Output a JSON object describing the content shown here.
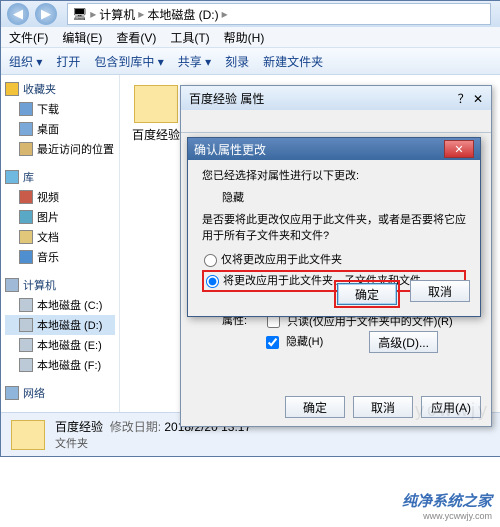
{
  "titlebar": {
    "back_glyph": "◀",
    "fwd_glyph": "▶",
    "crumb_icon": "🖥",
    "crumb1": "计算机",
    "crumb2": "本地磁盘 (D:)",
    "sep": "▸"
  },
  "menubar": {
    "file": "文件(F)",
    "edit": "编辑(E)",
    "view": "查看(V)",
    "tools": "工具(T)",
    "help": "帮助(H)"
  },
  "toolbar": {
    "organize": "组织 ▾",
    "open": "打开",
    "include": "包含到库中 ▾",
    "share": "共享 ▾",
    "burn": "刻录",
    "newfolder": "新建文件夹"
  },
  "sidebar": {
    "fav": {
      "header": "收藏夹",
      "items": [
        "下载",
        "桌面",
        "最近访问的位置"
      ]
    },
    "lib": {
      "header": "库",
      "items": [
        "视频",
        "图片",
        "文档",
        "音乐"
      ]
    },
    "comp": {
      "header": "计算机",
      "items": [
        "本地磁盘 (C:)",
        "本地磁盘 (D:)",
        "本地磁盘 (E:)",
        "本地磁盘 (F:)"
      ]
    },
    "net": {
      "header": "网络"
    }
  },
  "main": {
    "folder_name": "百度经验"
  },
  "status": {
    "name": "百度经验",
    "date_label": "修改日期:",
    "date": "2018/2/20 13:17",
    "type": "文件夹"
  },
  "prop_dialog": {
    "title": "百度经验 属性",
    "attr_label": "属性:",
    "readonly": "只读(仅应用于文件夹中的文件)(R)",
    "hidden": "隐藏(H)",
    "advanced": "高级(D)...",
    "ok": "确定",
    "cancel": "取消",
    "apply": "应用(A)"
  },
  "confirm_dialog": {
    "title": "确认属性更改",
    "line1": "您已经选择对属性进行以下更改:",
    "change": "隐藏",
    "line2": "是否要将此更改仅应用于此文件夹，或者是否要将它应用于所有子文件夹和文件?",
    "opt1": "仅将更改应用于此文件夹",
    "opt2": "将更改应用于此文件夹、子文件夹和文件",
    "ok": "确定",
    "cancel": "取消",
    "close": "✕"
  },
  "watermark": {
    "faint": "ycwwjy",
    "brand": "纯净系统之家",
    "url": "www.ycwwjy.com"
  }
}
